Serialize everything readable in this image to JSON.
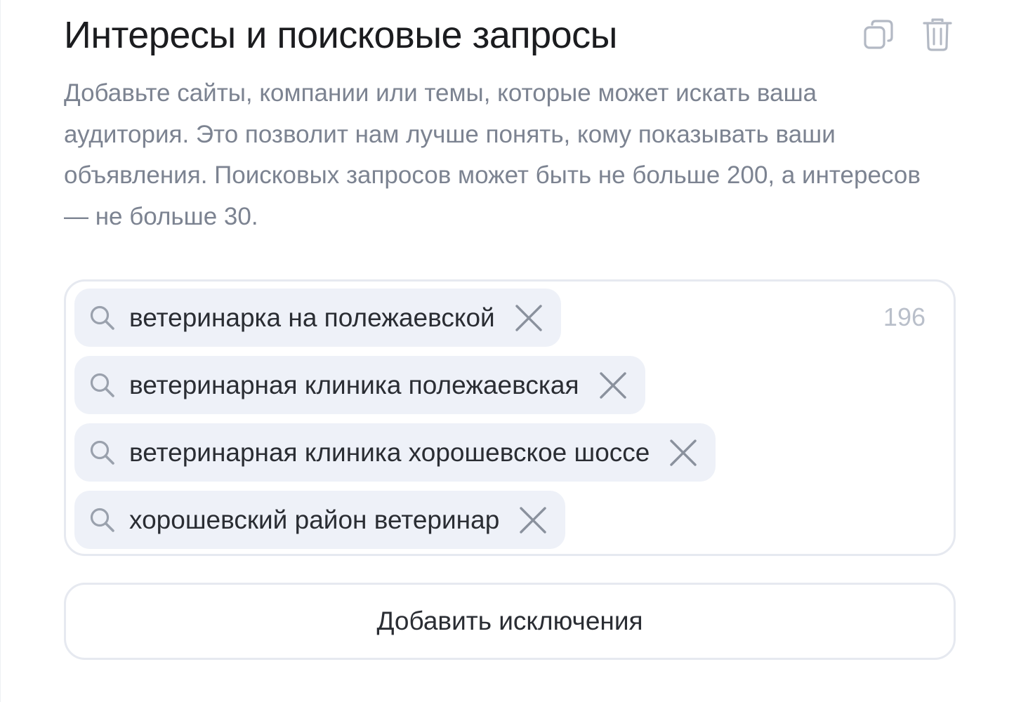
{
  "header": {
    "title": "Интересы и поисковые запросы",
    "actions": [
      {
        "icon": "copy-icon"
      },
      {
        "icon": "trash-icon"
      }
    ]
  },
  "description": "Добавьте сайты, компании или темы, которые может искать ваша аудитория. Это позволит нам лучше понять, кому показывать ваши объявления. Поисковых запросов может быть не больше 200, а интересов — не больше 30.",
  "query_box": {
    "counter": "196",
    "chip_icon": "search-icon",
    "remove_icon": "close-icon",
    "chips": [
      {
        "text": "ветеринарка на полежаевской"
      },
      {
        "text": "ветеринарная клиника полежаевская"
      },
      {
        "text": "ветеринарная клиника хорошевское шоссе"
      },
      {
        "text": "хорошевский район ветеринар"
      }
    ]
  },
  "add_exclusions_button": {
    "label": "Добавить исключения"
  },
  "colors": {
    "title": "#1b1c1f",
    "description": "#7c8391",
    "chip_background": "#eef1f8",
    "border": "#e6e9f0",
    "icon": "#9aa1ad",
    "counter": "#b9bfca"
  }
}
